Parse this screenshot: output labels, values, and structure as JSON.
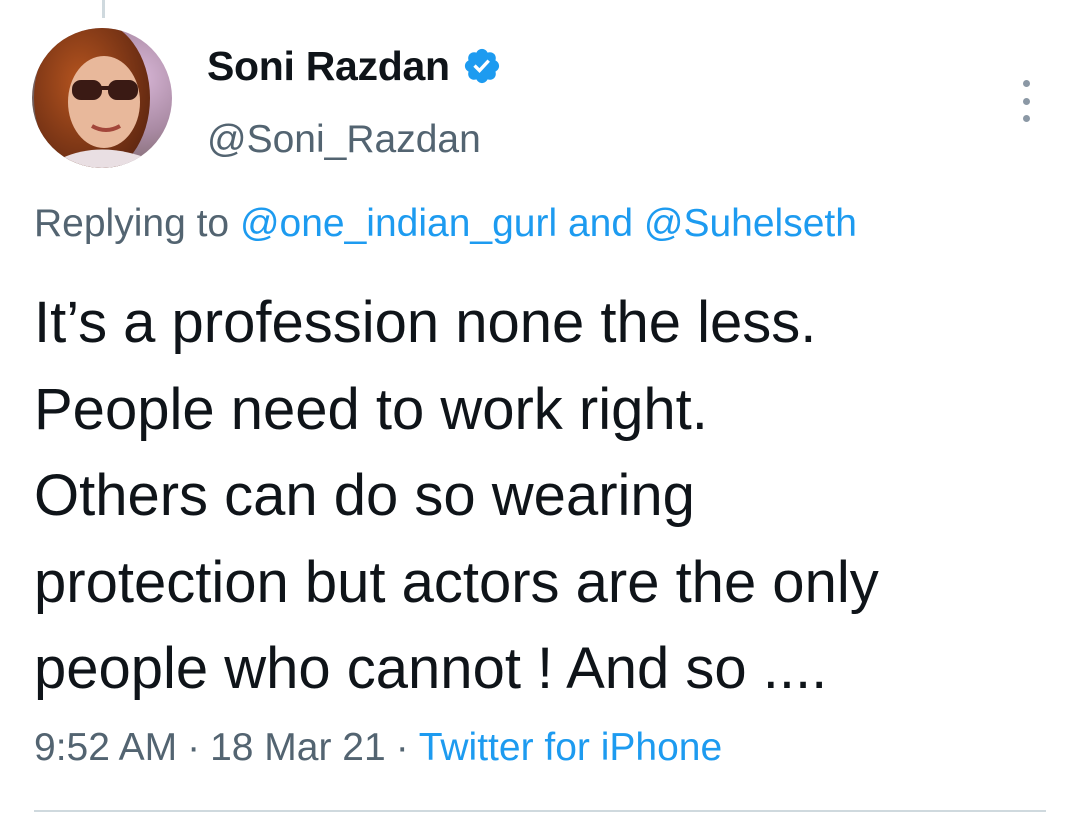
{
  "author": {
    "display_name": "Soni Razdan",
    "handle": "@Soni_Razdan",
    "verified": true
  },
  "reply": {
    "prefix": "Replying to ",
    "user1": "@one_indian_gurl",
    "conjunction": " and ",
    "user2": "@Suhelseth"
  },
  "tweet": {
    "lines": [
      "It’s a profession none the less.",
      "People need to work right.",
      "Others can do so wearing",
      "protection but actors are the only",
      "people who cannot ! And so ...."
    ]
  },
  "meta": {
    "time": "9:52 AM",
    "separator": "·",
    "date": "18 Mar 21",
    "source": "Twitter for iPhone"
  },
  "colors": {
    "accent": "#1d9bf0",
    "secondary_text": "#536471",
    "primary_text": "#0f1419"
  },
  "icons": {
    "verified": "verified-badge-icon",
    "more": "more-options-icon"
  }
}
